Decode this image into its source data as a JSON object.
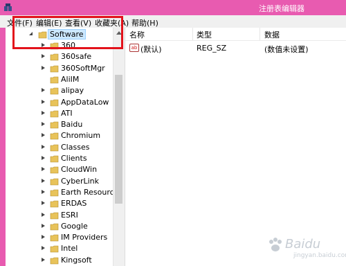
{
  "window": {
    "title": "注册表编辑器"
  },
  "menu": [
    "文件(F)",
    "编辑(E)",
    "查看(V)",
    "收藏夹(A)",
    "帮助(H)"
  ],
  "tree": {
    "root": "Software",
    "items": [
      "360",
      "360safe",
      "360SoftMgr",
      "AliIM",
      "alipay",
      "AppDataLow",
      "ATI",
      "Baidu",
      "Chromium",
      "Classes",
      "Clients",
      "CloudWin",
      "CyberLink",
      "Earth Resource M",
      "ERDAS",
      "ESRI",
      "Google",
      "IM Providers",
      "Intel",
      "Kingsoft"
    ]
  },
  "columns": {
    "name": "名称",
    "type": "类型",
    "data": "数据"
  },
  "values": [
    {
      "icon": "ab",
      "name": "(默认)",
      "type": "REG_SZ",
      "data": "(数值未设置)"
    }
  ],
  "watermark": {
    "text": "Baidu",
    "sub": "jingyan.baidu.com"
  },
  "colors": {
    "titlebar": "#e85bb0",
    "highlight": "#e3121b",
    "folder": "#e8c35a"
  }
}
